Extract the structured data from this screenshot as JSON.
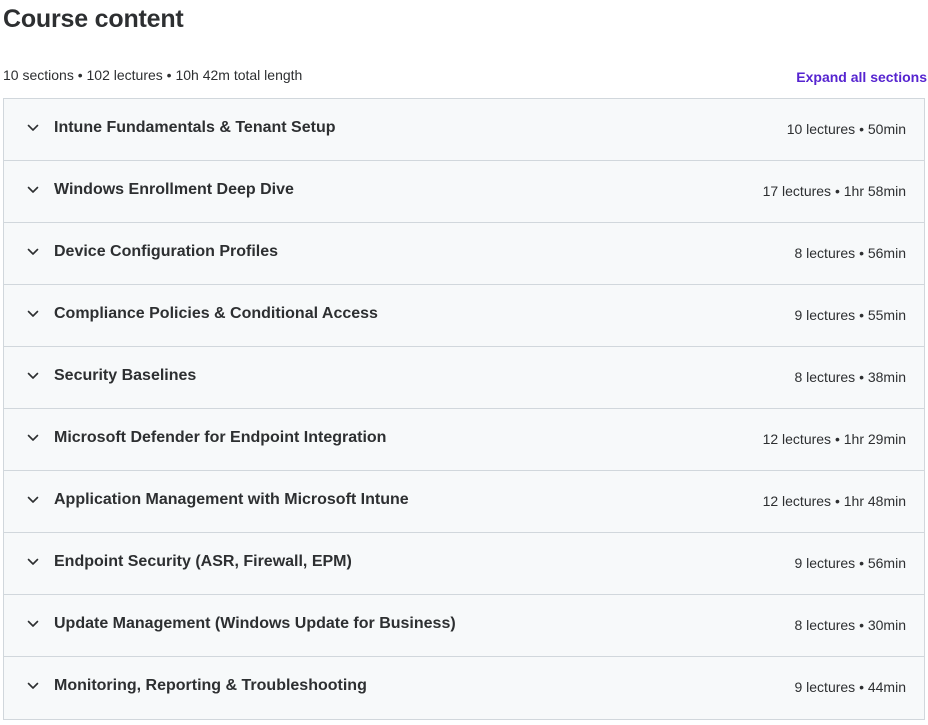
{
  "header": {
    "title": "Course content"
  },
  "summary": {
    "text": "10 sections • 102 lectures • 10h 42m total length",
    "expand_label": "Expand all sections"
  },
  "colors": {
    "accent": "#5624d0",
    "section_bg": "#f7f9fa",
    "border": "#d1d7dc",
    "text": "#2d2f31"
  },
  "sections": [
    {
      "title": "Intune Fundamentals & Tenant Setup",
      "meta": "10 lectures • 50min",
      "icon": "chevron-down-icon"
    },
    {
      "title": "Windows Enrollment Deep Dive",
      "meta": "17 lectures • 1hr 58min",
      "icon": "chevron-down-icon"
    },
    {
      "title": "Device Configuration Profiles",
      "meta": "8 lectures • 56min",
      "icon": "chevron-down-icon"
    },
    {
      "title": "Compliance Policies & Conditional Access",
      "meta": "9 lectures • 55min",
      "icon": "chevron-down-icon"
    },
    {
      "title": "Security Baselines",
      "meta": "8 lectures • 38min",
      "icon": "chevron-down-icon"
    },
    {
      "title": "Microsoft Defender for Endpoint Integration",
      "meta": "12 lectures • 1hr 29min",
      "icon": "chevron-down-icon"
    },
    {
      "title": "Application Management with Microsoft Intune",
      "meta": "12 lectures • 1hr 48min",
      "icon": "chevron-down-icon"
    },
    {
      "title": "Endpoint Security (ASR, Firewall, EPM)",
      "meta": "9 lectures • 56min",
      "icon": "chevron-down-icon"
    },
    {
      "title": "Update Management (Windows Update for Business)",
      "meta": "8 lectures • 30min",
      "icon": "chevron-down-icon"
    },
    {
      "title": "Monitoring, Reporting & Troubleshooting",
      "meta": "9 lectures • 44min",
      "icon": "chevron-down-icon"
    }
  ]
}
